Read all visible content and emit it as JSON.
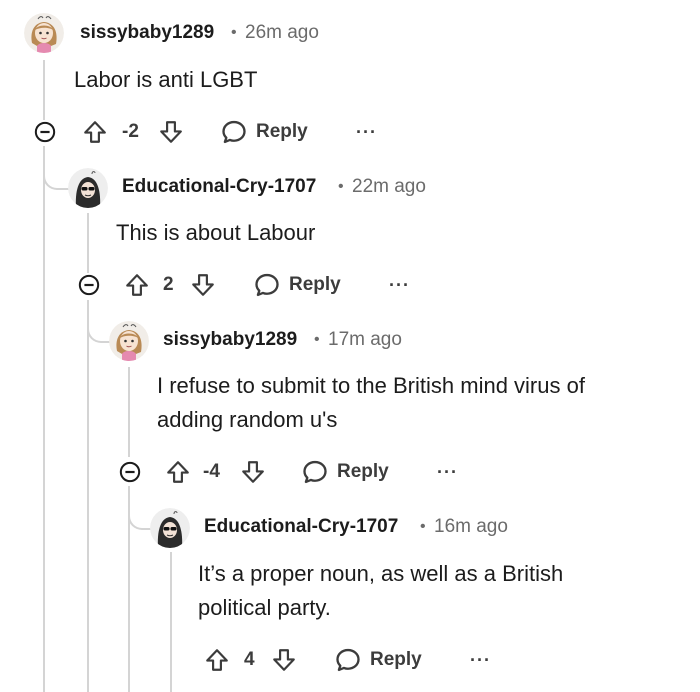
{
  "comments": [
    {
      "author": "sissybaby1289",
      "time": "26m ago",
      "body": "Labor is anti LGBT",
      "score": "-2",
      "reply_label": "Reply",
      "more_label": "···",
      "avatar": "anime-girl-avatar"
    },
    {
      "author": "Educational-Cry-1707",
      "time": "22m ago",
      "body": "This is about Labour",
      "score": "2",
      "reply_label": "Reply",
      "more_label": "···",
      "avatar": "hooded-figure-sunglasses-avatar"
    },
    {
      "author": "sissybaby1289",
      "time": "17m ago",
      "body": "I refuse to submit to the British mind virus of adding random u's",
      "score": "-4",
      "reply_label": "Reply",
      "more_label": "···",
      "avatar": "anime-girl-avatar"
    },
    {
      "author": "Educational-Cry-1707",
      "time": "16m ago",
      "body": "It’s a proper noun, as well as a British political party.",
      "score": "4",
      "reply_label": "Reply",
      "more_label": "···",
      "avatar": "hooded-figure-sunglasses-avatar"
    }
  ],
  "meta_separator": "•",
  "colors": {
    "text": "#1c1c1c",
    "muted": "#6b6b6b",
    "thread_line": "#d4d4d4",
    "accent_pink": "#e58ab0"
  }
}
